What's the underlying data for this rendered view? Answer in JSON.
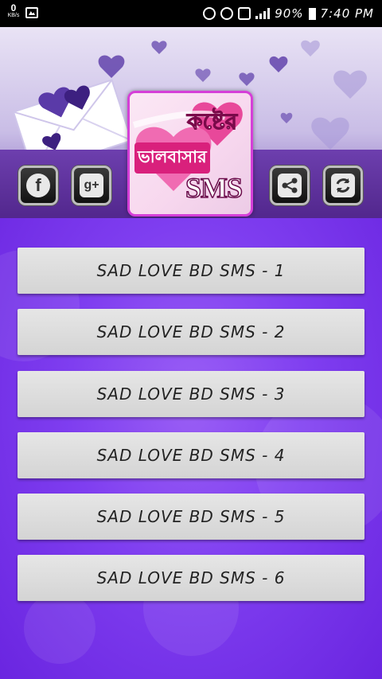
{
  "status_bar": {
    "speed_value": "0",
    "speed_unit": "KB/s",
    "battery_percent": "90%",
    "time": "7:40 PM"
  },
  "header": {
    "logo_line1": "কষ্টের",
    "logo_line2": "ভালবাসার",
    "logo_line3": "SMS",
    "buttons": {
      "facebook_label": "f",
      "google_plus_label": "g+"
    }
  },
  "menu": {
    "items": [
      {
        "label": "SAD LOVE BD SMS - 1"
      },
      {
        "label": "SAD LOVE BD SMS - 2"
      },
      {
        "label": "SAD LOVE BD SMS - 3"
      },
      {
        "label": "SAD LOVE BD SMS - 4"
      },
      {
        "label": "SAD LOVE BD SMS - 5"
      },
      {
        "label": "SAD LOVE BD SMS - 6"
      }
    ]
  },
  "colors": {
    "main_purple": "#7f3ef0",
    "logo_pink": "#d9207c",
    "button_gray": "#dcdcdc"
  }
}
